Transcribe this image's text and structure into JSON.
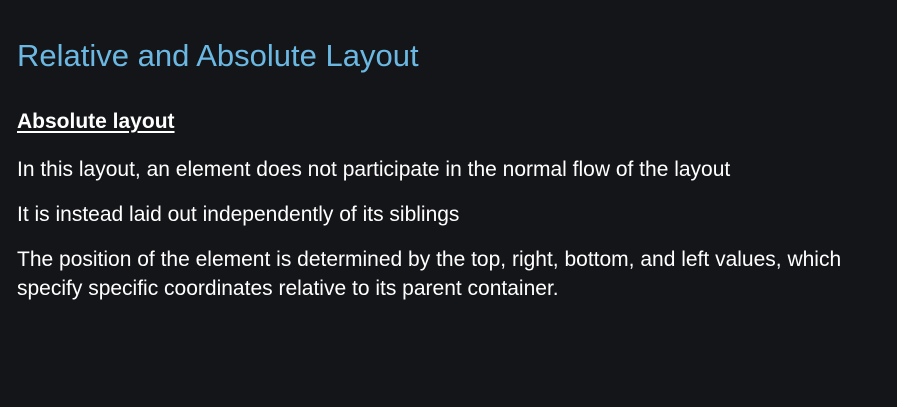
{
  "slide": {
    "title": "Relative and Absolute Layout",
    "heading": "Absolute layout",
    "paragraphs": [
      "In this layout, an element does not participate in the normal flow of the layout",
      "It is instead laid out independently of its siblings",
      "The position of the element is determined by the top, right, bottom, and left values, which specify specific coordinates relative to its parent container."
    ]
  },
  "colors": {
    "background": "#141519",
    "title": "#6bb8e3",
    "text": "#ffffff"
  }
}
